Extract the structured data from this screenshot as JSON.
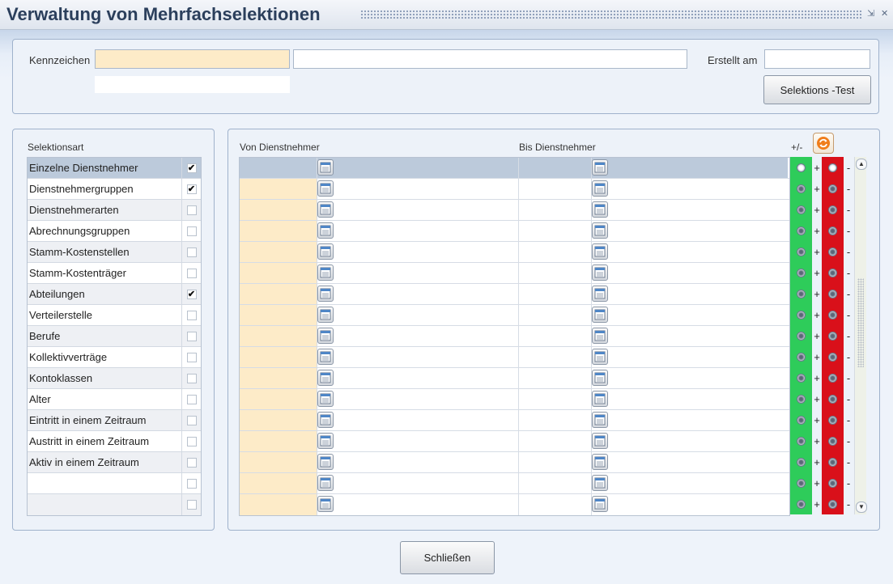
{
  "window": {
    "title": "Verwaltung von Mehrfachselektionen",
    "minimize_glyph": "⇲",
    "close_glyph": "✕"
  },
  "header": {
    "kennzeichen_label": "Kennzeichen",
    "kennzeichen_value": "",
    "bezeichnung_value": "",
    "erstellt_am_label": "Erstellt am",
    "erstellt_am_value": "",
    "test_button": "Selektions -Test"
  },
  "selection": {
    "header": "Selektionsart",
    "items": [
      {
        "label": "Einzelne Dienstnehmer",
        "checked": true
      },
      {
        "label": "Dienstnehmergruppen",
        "checked": true
      },
      {
        "label": "Dienstnehmerarten",
        "checked": false
      },
      {
        "label": "Abrechnungsgruppen",
        "checked": false
      },
      {
        "label": "Stamm-Kostenstellen",
        "checked": false
      },
      {
        "label": "Stamm-Kostenträger",
        "checked": false
      },
      {
        "label": "Abteilungen",
        "checked": true
      },
      {
        "label": "Verteilerstelle",
        "checked": false
      },
      {
        "label": "Berufe",
        "checked": false
      },
      {
        "label": "Kollektivverträge",
        "checked": false
      },
      {
        "label": "Kontoklassen",
        "checked": false
      },
      {
        "label": "Alter",
        "checked": false
      },
      {
        "label": "Eintritt in einem Zeitraum",
        "checked": false
      },
      {
        "label": "Austritt in einem Zeitraum",
        "checked": false
      },
      {
        "label": "Aktiv in einem Zeitraum",
        "checked": false
      },
      {
        "label": "",
        "checked": false
      },
      {
        "label": "",
        "checked": false
      }
    ]
  },
  "range": {
    "von_header": "Von Dienstnehmer",
    "bis_header": "Bis Dienstnehmer",
    "pm_header": "+/-",
    "plus": "+",
    "minus": "-",
    "row_count": 17
  },
  "icons": {
    "calendar": "calendar-icon",
    "refresh": "refresh-icon"
  },
  "colors": {
    "required_field": "#fdebc8",
    "plus_green": "#2ecc5a",
    "minus_red": "#d9101a",
    "selected_row": "#bccadb"
  },
  "footer": {
    "close_button": "Schließen"
  }
}
